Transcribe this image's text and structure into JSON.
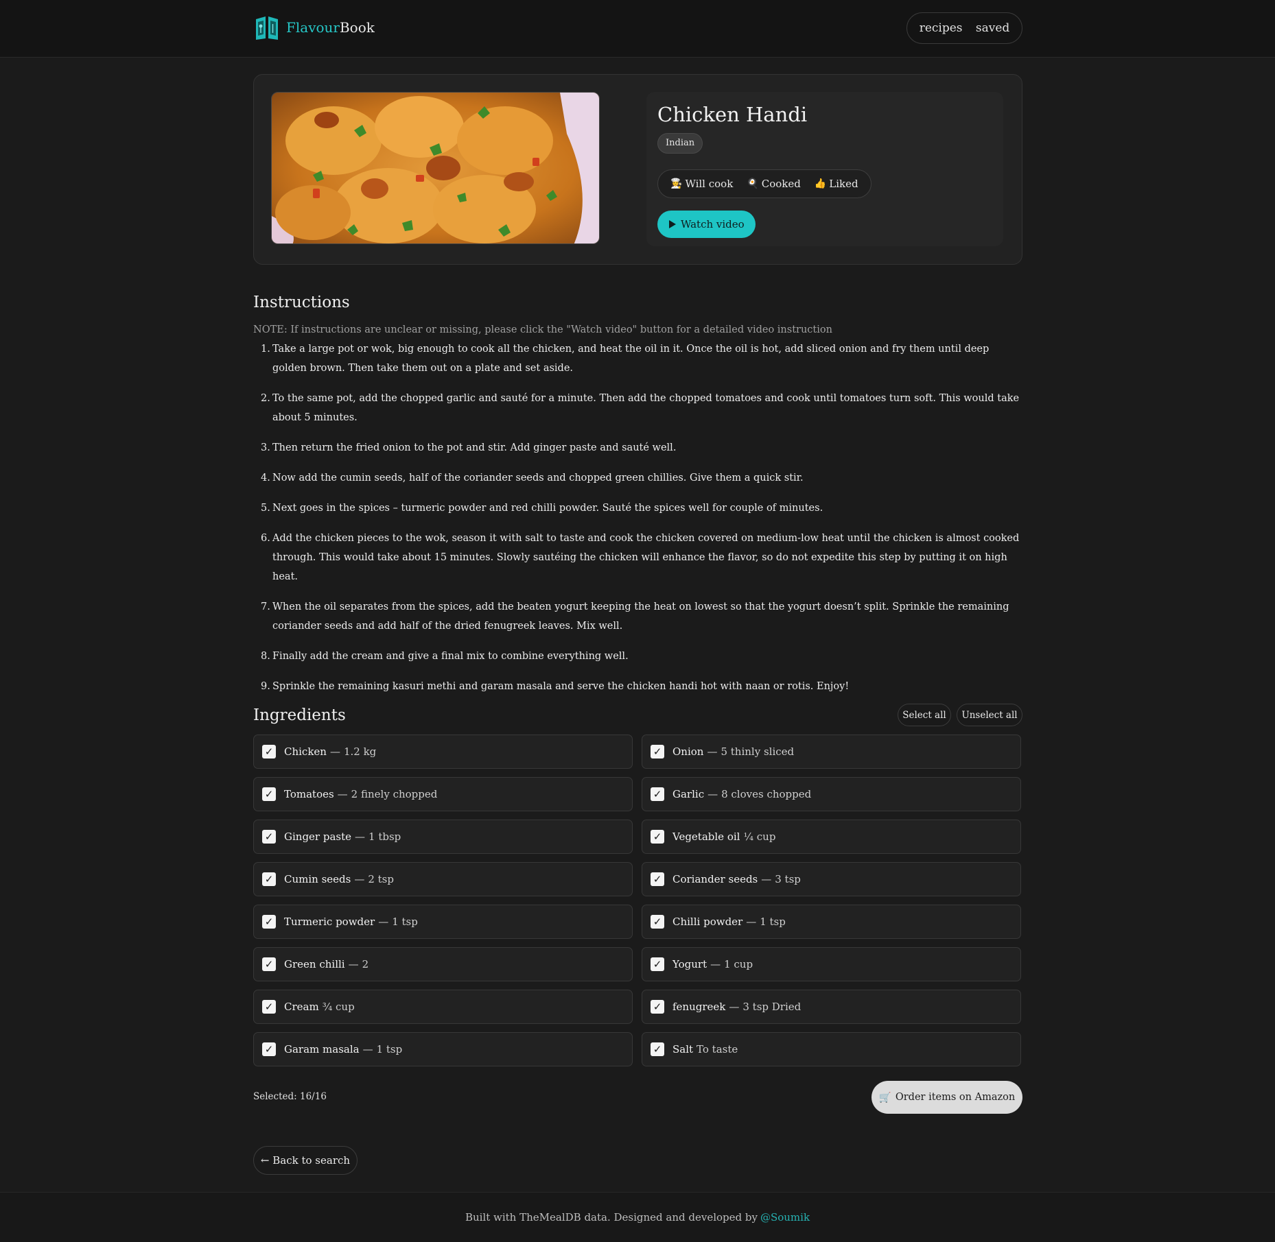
{
  "brand": {
    "part1": "Flavour",
    "part2": "Book",
    "accent": "#26c6c6",
    "icon": "open-book-icon"
  },
  "nav": {
    "recipes": "recipes",
    "saved": "saved"
  },
  "recipe": {
    "title": "Chicken Handi",
    "cuisine": "Indian",
    "status": [
      {
        "icon": "chef-icon",
        "label": "Will cook"
      },
      {
        "icon": "pan-icon",
        "label": "Cooked"
      },
      {
        "icon": "thumbs-up-icon",
        "label": "Liked"
      }
    ],
    "watch_label": "Watch video"
  },
  "instructions": {
    "title": "Instructions",
    "note": "NOTE: If instructions are unclear or missing, please click the \"Watch video\" button for a detailed video instruction",
    "steps": [
      "Take a large pot or wok, big enough to cook all the chicken, and heat the oil in it. Once the oil is hot, add sliced onion and fry them until deep golden brown. Then take them out on a plate and set aside.",
      "To the same pot, add the chopped garlic and sauté for a minute. Then add the chopped tomatoes and cook until tomatoes turn soft. This would take about 5 minutes.",
      "Then return the fried onion to the pot and stir. Add ginger paste and sauté well.",
      "Now add the cumin seeds, half of the coriander seeds and chopped green chillies. Give them a quick stir.",
      "Next goes in the spices – turmeric powder and red chilli powder. Sauté the spices well for couple of minutes.",
      "Add the chicken pieces to the wok, season it with salt to taste and cook the chicken covered on medium-low heat until the chicken is almost cooked through. This would take about 15 minutes. Slowly sautéing the chicken will enhance the flavor, so do not expedite this step by putting it on high heat.",
      "When the oil separates from the spices, add the beaten yogurt keeping the heat on lowest so that the yogurt doesn’t split. Sprinkle the remaining coriander seeds and add half of the dried fenugreek leaves. Mix well.",
      "Finally add the cream and give a final mix to combine everything well.",
      "Sprinkle the remaining kasuri methi and garam masala and serve the chicken handi hot with naan or rotis. Enjoy!"
    ]
  },
  "ingredients": {
    "title": "Ingredients",
    "select_all": "Select all",
    "unselect_all": "Unselect all",
    "items": [
      {
        "name": "Chicken",
        "sep": "—",
        "measure": "1.2 kg",
        "checked": true
      },
      {
        "name": "Onion",
        "sep": "—",
        "measure": "5 thinly sliced",
        "checked": true
      },
      {
        "name": "Tomatoes",
        "sep": "—",
        "measure": "2 finely chopped",
        "checked": true
      },
      {
        "name": "Garlic",
        "sep": "—",
        "measure": "8 cloves chopped",
        "checked": true
      },
      {
        "name": "Ginger paste",
        "sep": "—",
        "measure": "1 tbsp",
        "checked": true
      },
      {
        "name": "Vegetable oil",
        "sep": "",
        "measure": "¼ cup",
        "checked": true
      },
      {
        "name": "Cumin seeds",
        "sep": "—",
        "measure": "2 tsp",
        "checked": true
      },
      {
        "name": "Coriander seeds",
        "sep": "—",
        "measure": "3 tsp",
        "checked": true
      },
      {
        "name": "Turmeric powder",
        "sep": "—",
        "measure": "1 tsp",
        "checked": true
      },
      {
        "name": "Chilli powder",
        "sep": "—",
        "measure": "1 tsp",
        "checked": true
      },
      {
        "name": "Green chilli",
        "sep": "—",
        "measure": "2",
        "checked": true
      },
      {
        "name": "Yogurt",
        "sep": "—",
        "measure": "1 cup",
        "checked": true
      },
      {
        "name": "Cream",
        "sep": "",
        "measure": "¾ cup",
        "checked": true
      },
      {
        "name": "fenugreek",
        "sep": "—",
        "measure": "3 tsp Dried",
        "checked": true
      },
      {
        "name": "Garam masala",
        "sep": "—",
        "measure": "1 tsp",
        "checked": true
      },
      {
        "name": "Salt",
        "sep": "",
        "measure": "To taste",
        "checked": true
      }
    ],
    "selected_text": "Selected: 16/16",
    "order_label": "Order items on Amazon",
    "order_icon": "cart-icon"
  },
  "back_label": "← Back to search",
  "footer": {
    "text": "Built with TheMealDB data. Designed and developed by",
    "author": "@Soumik"
  }
}
